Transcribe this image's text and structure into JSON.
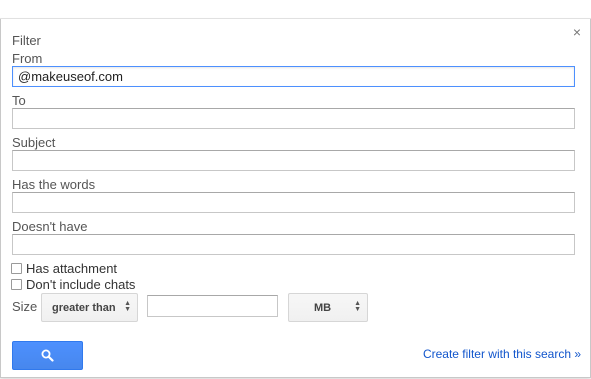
{
  "dialog": {
    "title": "Filter",
    "close_glyph": "×",
    "fields": {
      "from": {
        "label": "From",
        "value": "@makeuseof.com"
      },
      "to": {
        "label": "To",
        "value": ""
      },
      "subject": {
        "label": "Subject",
        "value": ""
      },
      "has_words": {
        "label": "Has the words",
        "value": ""
      },
      "doesnt_have": {
        "label": "Doesn't have",
        "value": ""
      }
    },
    "checkboxes": {
      "has_attachment": {
        "label": "Has attachment",
        "checked": false
      },
      "no_chats": {
        "label": "Don't include chats",
        "checked": false
      }
    },
    "size": {
      "label": "Size",
      "operator": "greater than",
      "value": "",
      "unit": "MB"
    },
    "search_button": {
      "icon": "search-icon",
      "color": "#4d90fe"
    },
    "create_link": "Create filter with this search »"
  }
}
